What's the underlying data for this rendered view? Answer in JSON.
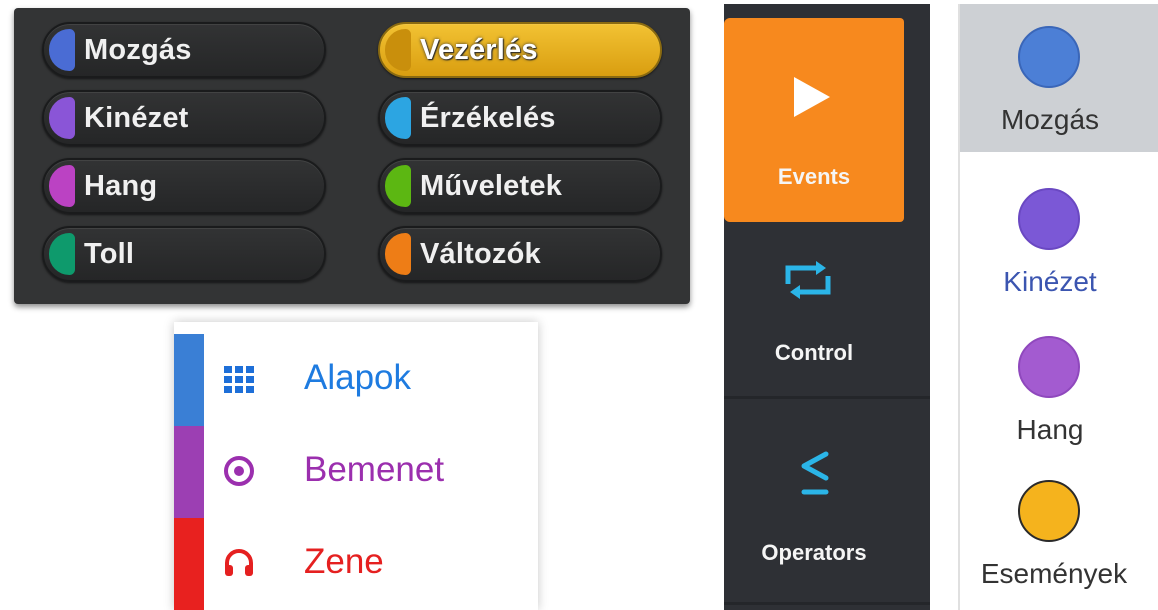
{
  "scratch_categories": {
    "items": [
      {
        "label": "Mozgás",
        "color": "#4a6cd4"
      },
      {
        "label": "Vezérlés",
        "color": "#e1a91a",
        "selected": true
      },
      {
        "label": "Kinézet",
        "color": "#8a55d7"
      },
      {
        "label": "Érzékelés",
        "color": "#2ca5e2"
      },
      {
        "label": "Hang",
        "color": "#bb42c3"
      },
      {
        "label": "Műveletek",
        "color": "#5cb712"
      },
      {
        "label": "Toll",
        "color": "#0e9a6c"
      },
      {
        "label": "Változók",
        "color": "#ee7d16"
      }
    ]
  },
  "makecode_categories": {
    "items": [
      {
        "label": "Alapok",
        "icon": "grid-icon",
        "color": "#1e90ff",
        "bar_color": "#3a7fd5"
      },
      {
        "label": "Bemenet",
        "icon": "target-icon",
        "color": "#9b2fae",
        "bar_color": "#9c3fb3"
      },
      {
        "label": "Zene",
        "icon": "headphone-icon",
        "color": "#e52020",
        "bar_color": "#e8211f"
      }
    ]
  },
  "dark_sidebar": {
    "items": [
      {
        "label": "Events",
        "icon": "play-icon",
        "selected": true
      },
      {
        "label": "Control",
        "icon": "repeat-icon"
      },
      {
        "label": "Operators",
        "icon": "less-equal-icon"
      }
    ],
    "accent": "#f7891e",
    "icon_color": "#2bb5e8"
  },
  "light_categories": {
    "items": [
      {
        "label": "Mozgás",
        "color": "#4c7fd6",
        "text_color": "#333333",
        "selected": true
      },
      {
        "label": "Kinézet",
        "color": "#7b58d6",
        "text_color": "#3b55b0"
      },
      {
        "label": "Hang",
        "color": "#a35bd0",
        "text_color": "#333333"
      },
      {
        "label": "Események",
        "color": "#f5b31d",
        "text_color": "#333333"
      }
    ]
  }
}
